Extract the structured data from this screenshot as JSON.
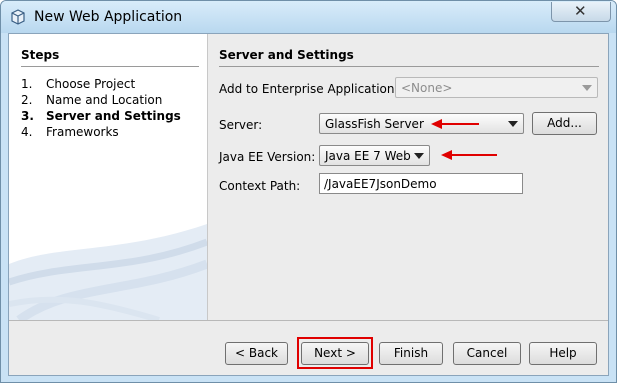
{
  "window": {
    "title": "New Web Application",
    "close_label": "✕"
  },
  "steps": {
    "title": "Steps",
    "items": [
      {
        "num": "1.",
        "label": "Choose Project"
      },
      {
        "num": "2.",
        "label": "Name and Location"
      },
      {
        "num": "3.",
        "label": "Server and Settings"
      },
      {
        "num": "4.",
        "label": "Frameworks"
      }
    ]
  },
  "panel": {
    "title": "Server and Settings",
    "enterprise_label": "Add to Enterprise Application:",
    "enterprise_value": "<None>",
    "server_label": "Server:",
    "server_value": "GlassFish Server",
    "add_label": "Add...",
    "javaee_label": "Java EE Version:",
    "javaee_value": "Java EE 7 Web",
    "context_label": "Context Path:",
    "context_value": "/JavaEE7JsonDemo"
  },
  "buttons": {
    "back": "< Back",
    "next": "Next >",
    "finish": "Finish",
    "cancel": "Cancel",
    "help": "Help"
  },
  "colors": {
    "annotation": "#e00000"
  }
}
